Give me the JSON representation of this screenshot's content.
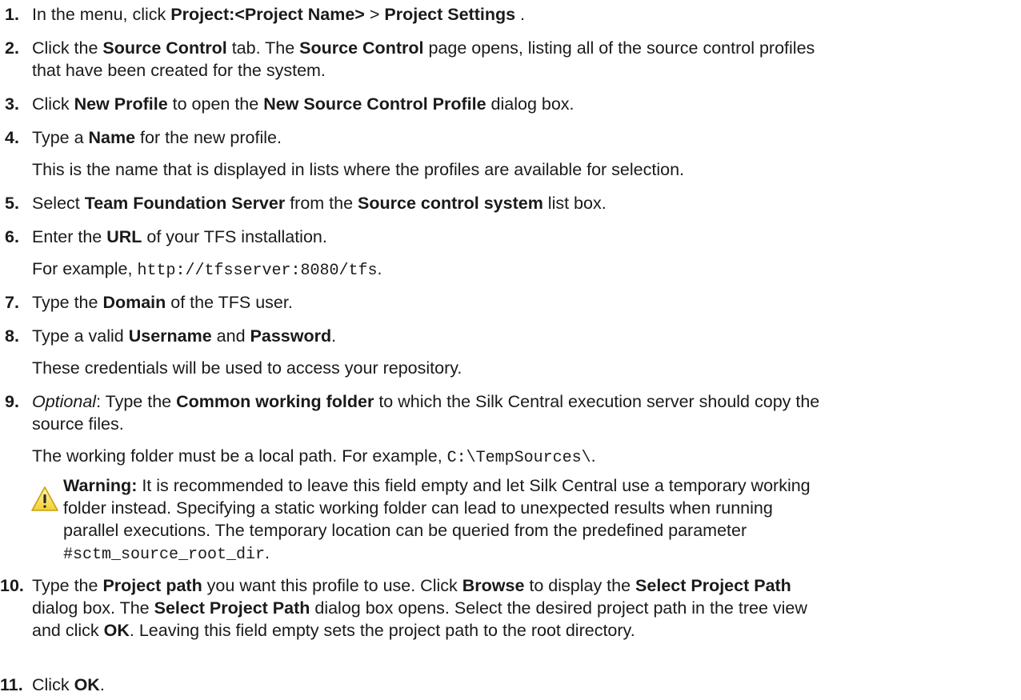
{
  "steps": [
    {
      "n": "1.",
      "a": "In the menu, click ",
      "b1": "Project:<Project Name>",
      "c": " > ",
      "b2": "Project Settings",
      "d": " ."
    },
    {
      "n": "2.",
      "a": "Click the ",
      "b1": "Source Control",
      "c": " tab. The ",
      "b2": "Source Control",
      "d": " page opens, listing all of the source control profiles",
      "l2": "that have been created for the system."
    },
    {
      "n": "3.",
      "a": "Click ",
      "b1": "New Profile",
      "c": " to open the ",
      "b2": "New Source Control Profile",
      "d": " dialog box."
    },
    {
      "n": "4.",
      "a": "Type a ",
      "b1": "Name",
      "c": " for the new profile.",
      "sub": "This is the name that is displayed in lists where the profiles are available for selection."
    },
    {
      "n": "5.",
      "a": "Select ",
      "b1": "Team Foundation Server",
      "c": " from the ",
      "b2": "Source control system",
      "d": " list box."
    },
    {
      "n": "6.",
      "a": "Enter the ",
      "b1": "URL",
      "c": " of your TFS installation.",
      "sub_a": "For example, ",
      "sub_code": "http://tfsserver:8080/tfs",
      "sub_b": "."
    },
    {
      "n": "7.",
      "a": "Type the ",
      "b1": "Domain",
      "c": " of the TFS user."
    },
    {
      "n": "8.",
      "a": "Type a valid ",
      "b1": "Username",
      "c": " and ",
      "b2": "Password",
      "d": ".",
      "sub": "These credentials will be used to access your repository."
    },
    {
      "n": "9.",
      "i": "Optional",
      "a": ": Type the ",
      "b1": "Common working folder",
      "c": " to which the Silk Central execution server should copy the",
      "l2": "source files.",
      "sub_a": "The working folder must be a local path. For example, ",
      "sub_code": "C:\\TempSources\\",
      "sub_b": "."
    },
    {
      "n": "10.",
      "a": "Type the ",
      "b1": "Project path",
      "c": " you want this profile to use. Click ",
      "b2": "Browse",
      "d": " to display the ",
      "b3": "Select Project Path",
      "l2a": "dialog box. The ",
      "l2b": "Select Project Path",
      "l2c": " dialog box opens. Select the desired project path in the tree view",
      "l3a": "and click ",
      "l3b": "OK",
      "l3c": ". Leaving this field empty sets the project path to the root directory."
    },
    {
      "n": "11.",
      "a": "Click ",
      "b1": "OK",
      "c": "."
    }
  ],
  "warning": {
    "icon": "warning-triangle-icon",
    "label": "Warning:",
    "t1": " It is recommended to leave this field empty and let Silk Central use a temporary working",
    "t2": "folder instead. Specifying a static working folder can lead to unexpected results when running",
    "t3": "parallel executions. The temporary location can be queried from the predefined parameter",
    "code": "#sctm_source_root_dir",
    "end": "."
  }
}
